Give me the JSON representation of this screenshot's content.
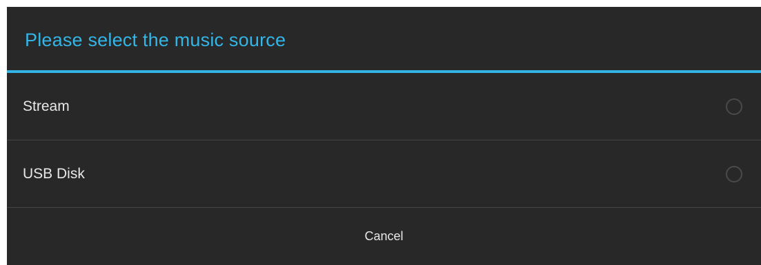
{
  "dialog": {
    "title": "Please select the music source",
    "options": [
      {
        "label": "Stream",
        "selected": false
      },
      {
        "label": "USB Disk",
        "selected": false
      }
    ],
    "cancel_label": "Cancel"
  },
  "colors": {
    "accent": "#33b5e5",
    "background": "#282828",
    "text": "#e8e8e8",
    "divider": "#454545"
  },
  "icons": {
    "radio": "radio-unselected-icon"
  }
}
